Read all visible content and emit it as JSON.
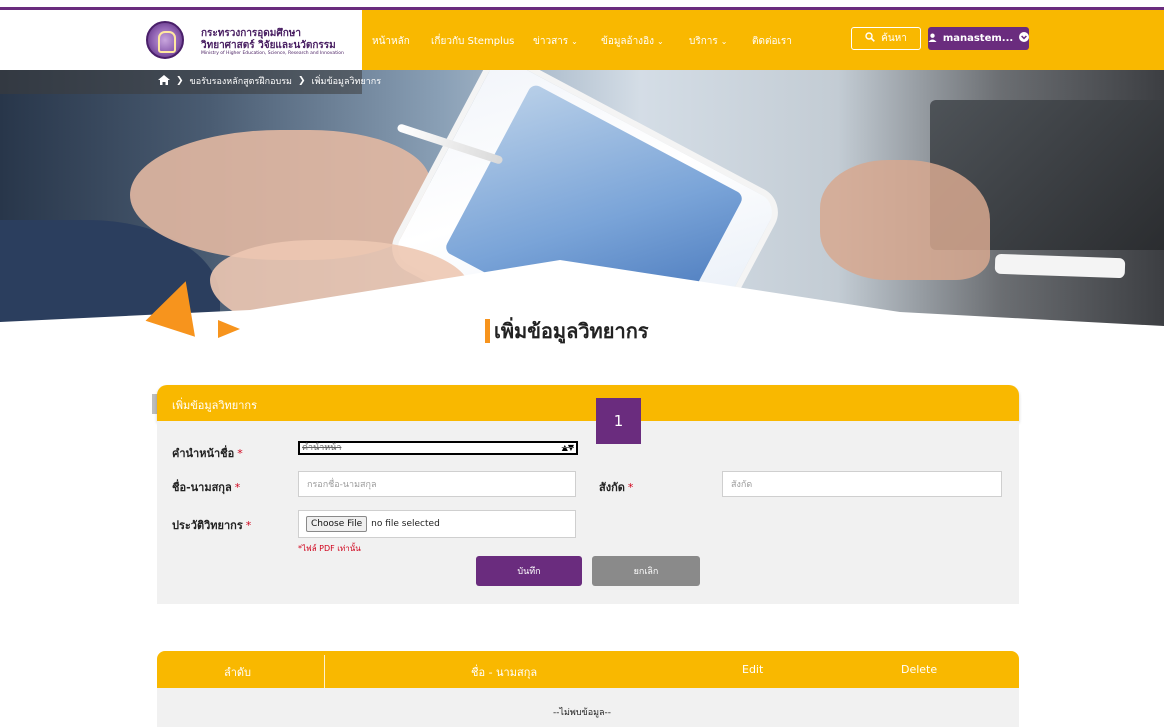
{
  "header": {
    "logo_line1": "กระทรวงการอุดมศึกษา",
    "logo_line2": "วิทยาศาสตร์ วิจัยและนวัตกรรม",
    "logo_line3": "Ministry of Higher Education, Science, Research and Innovation",
    "nav": [
      {
        "label": "หน้าหลัก",
        "has_dropdown": false
      },
      {
        "label": "เกี่ยวกับ Stemplus",
        "has_dropdown": false
      },
      {
        "label": "ข่าวสาร",
        "has_dropdown": true
      },
      {
        "label": "ข้อมูลอ้างอิง",
        "has_dropdown": true
      },
      {
        "label": "บริการ",
        "has_dropdown": true
      },
      {
        "label": "ติดต่อเรา",
        "has_dropdown": false
      }
    ],
    "search_label": "ค้นหา",
    "user_label": "manastem...",
    "colors": {
      "brand_purple": "#6a2c7e",
      "accent_yellow": "#f9b800"
    }
  },
  "breadcrumb": {
    "items": [
      "ขอรับรองหลักสูตรฝึกอบรม",
      "เพิ่มข้อมูลวิทยากร"
    ]
  },
  "page_title": "เพิ่มข้อมูลวิทยากร",
  "form": {
    "card_title": "เพิ่มข้อมูลวิทยากร",
    "badge": "1",
    "prefix_label": "คำนำหน้าชื่อ",
    "prefix_selected": "คำนำหน้า",
    "name_label": "ชื่อ-นามสกุล",
    "name_placeholder": "กรอกชื่อ-นามสกุล",
    "affiliation_label": "สังกัด",
    "affiliation_placeholder": "สังกัด",
    "cv_label": "ประวัติวิทยากร",
    "file_button": "Choose File",
    "file_status": "no file selected",
    "file_hint": "*ไฟล์ PDF เท่านั้น",
    "required_mark": "*",
    "save_label": "บันทึก",
    "cancel_label": "ยกเลิก"
  },
  "table": {
    "columns": [
      "ลำดับ",
      "ชื่อ - นามสกุล",
      "Edit",
      "Delete"
    ],
    "empty_text": "--ไม่พบข้อมูล--"
  }
}
